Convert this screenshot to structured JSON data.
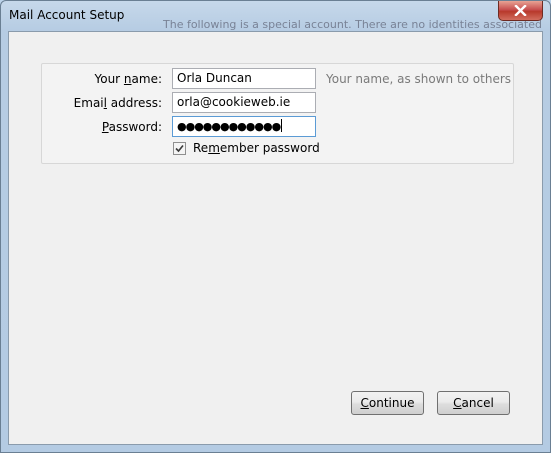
{
  "window": {
    "title": "Mail Account Setup",
    "background_text": "The following is a special account. There are no identities associated"
  },
  "form": {
    "name_label_pre": "Your ",
    "name_label_key": "n",
    "name_label_post": "ame:",
    "name_value": "Orla Duncan",
    "name_hint": "Your name, as shown to others",
    "email_label_pre": "Emai",
    "email_label_key": "l",
    "email_label_post": " address:",
    "email_value": "orla@cookieweb.ie",
    "password_label_pre": "",
    "password_label_key": "P",
    "password_label_post": "assword:",
    "password_value": "●●●●●●●●●●●●",
    "remember_label_pre": "Re",
    "remember_label_key": "m",
    "remember_label_post": "ember password",
    "remember_checked": true
  },
  "buttons": {
    "continue_key": "C",
    "continue_rest": "ontinue",
    "cancel_key": "C",
    "cancel_rest": "ancel"
  },
  "colors": {
    "accent_focus": "#5b9bd5",
    "close_button": "#c75050"
  }
}
